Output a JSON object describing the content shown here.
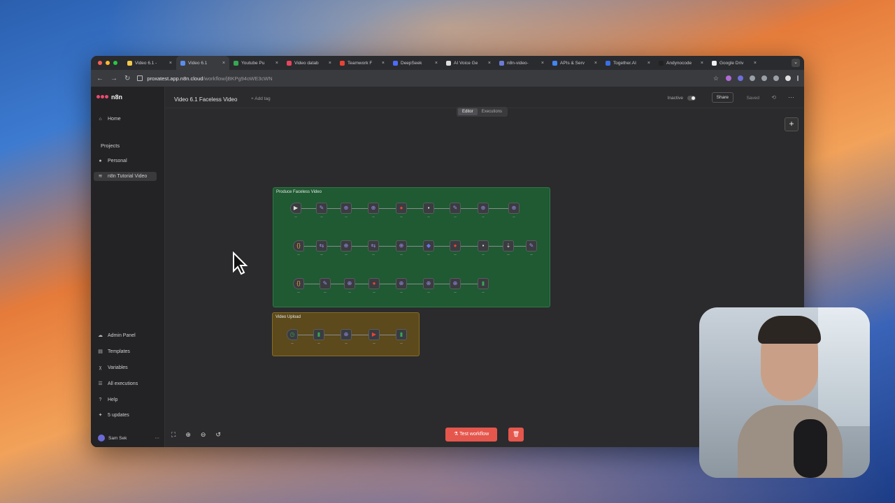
{
  "browser": {
    "tabs": [
      {
        "title": "Video 6.1 - ",
        "fav": "#f2c94c",
        "active": false
      },
      {
        "title": "Video 6.1",
        "fav": "#5b8def",
        "active": true
      },
      {
        "title": "Youtube Pu",
        "fav": "#34a853",
        "active": false
      },
      {
        "title": "Video datab",
        "fav": "#e8455c",
        "active": false
      },
      {
        "title": "Teamwork F",
        "fav": "#ea4335",
        "active": false
      },
      {
        "title": "DeepSeek",
        "fav": "#4d6bfe",
        "active": false
      },
      {
        "title": "AI Voice Ge",
        "fav": "#dddddd",
        "active": false
      },
      {
        "title": "n8n-video-",
        "fav": "#6c7bd6",
        "active": false
      },
      {
        "title": "APIs & Serv",
        "fav": "#4285f4",
        "active": false
      },
      {
        "title": "Together.AI",
        "fav": "#3a6ee8",
        "active": false
      },
      {
        "title": "Andynocode",
        "fav": "#222222",
        "active": false
      },
      {
        "title": "Google Driv",
        "fav": "#f0f0f0",
        "active": false
      }
    ],
    "url_host": "proxatest.app.n8n.cloud",
    "url_path": "/workflow/jBKPg94oWE3cWN"
  },
  "sidebar": {
    "logo": "n8n",
    "home": "Home",
    "projects_heading": "Projects",
    "personal": "Personal",
    "project_selected": "n8n Tutorial Video",
    "admin": "Admin Panel",
    "templates": "Templates",
    "variables": "Variables",
    "executions": "All executions",
    "help": "Help",
    "updates": "5 updates",
    "user": "Sam Sek"
  },
  "header": {
    "workflow_title": "Video 6.1 Faceless Video",
    "add_tag": "+ Add tag",
    "tab_editor": "Editor",
    "tab_executions": "Executions",
    "status": "Inactive",
    "share": "Share",
    "saved": "Saved"
  },
  "canvas": {
    "sticky_main_title": "Produce Faceless Video",
    "sticky_upload_title": "Video Upload",
    "test_button": "Test workflow"
  },
  "colors": {
    "accent": "#ea4b71",
    "test_button": "#e5564d",
    "sticky_green": "#1f5a32",
    "sticky_yellow": "#5c4a1c"
  }
}
